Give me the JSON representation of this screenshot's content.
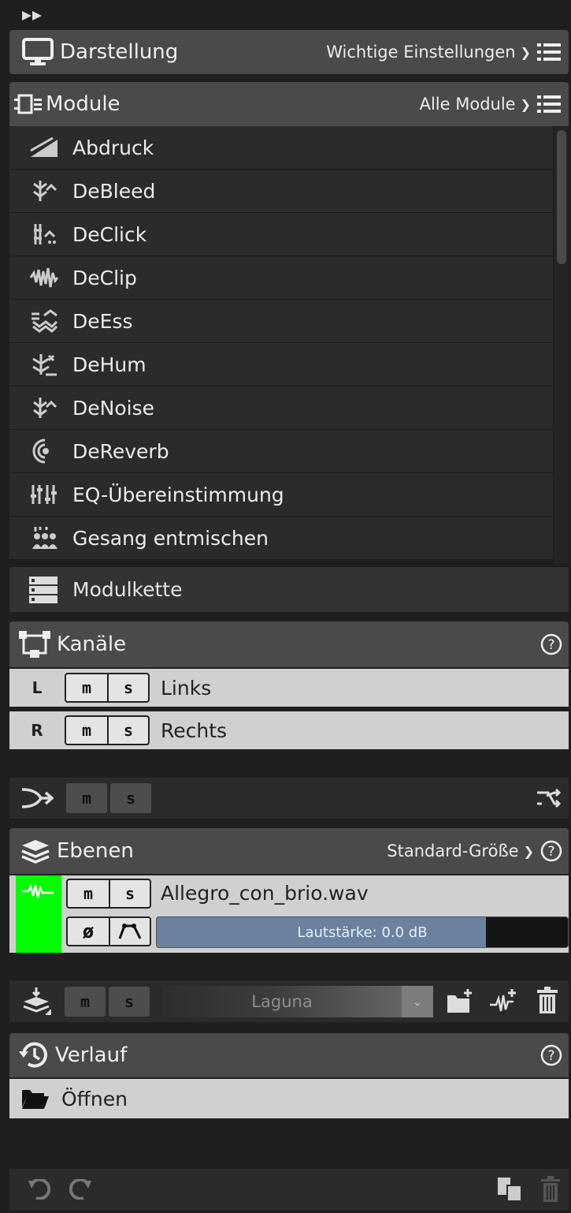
{
  "display": {
    "title": "Darstellung",
    "preset": "Wichtige Einstellungen"
  },
  "modules": {
    "title": "Module",
    "filter": "Alle Module",
    "items": [
      {
        "label": "Abdruck",
        "icon": "abdruck-icon"
      },
      {
        "label": "DeBleed",
        "icon": "debleed-icon"
      },
      {
        "label": "DeClick",
        "icon": "declick-icon"
      },
      {
        "label": "DeClip",
        "icon": "declip-icon"
      },
      {
        "label": "DeEss",
        "icon": "deess-icon"
      },
      {
        "label": "DeHum",
        "icon": "dehum-icon"
      },
      {
        "label": "DeNoise",
        "icon": "denoise-icon"
      },
      {
        "label": "DeReverb",
        "icon": "dereverb-icon"
      },
      {
        "label": "EQ-Übereinstimmung",
        "icon": "eq-match-icon"
      },
      {
        "label": "Gesang entmischen",
        "icon": "dialogue-isolate-icon"
      }
    ],
    "chain_label": "Modulkette"
  },
  "channels": {
    "title": "Kanäle",
    "rows": [
      {
        "letter": "L",
        "m": "m",
        "s": "s",
        "name": "Links"
      },
      {
        "letter": "R",
        "m": "m",
        "s": "s",
        "name": "Rechts"
      }
    ],
    "routing": {
      "m": "m",
      "s": "s"
    }
  },
  "layers": {
    "title": "Ebenen",
    "size": "Standard-Größe",
    "layer": {
      "m": "m",
      "s": "s",
      "file": "Allegro_con_brio.wav",
      "phase": "ø",
      "volume_text": "Lautstärke: 0.0 dB",
      "volume_fill": 0.8,
      "color": "#00ff00"
    },
    "bottom": {
      "m": "m",
      "s": "s",
      "preset": "Laguna"
    }
  },
  "history": {
    "title": "Verlauf",
    "items": [
      {
        "label": "Öffnen"
      }
    ]
  },
  "colors": {
    "panel_header": "#4a4a4a",
    "row_dark": "#2b2b2b",
    "row_light": "#d0d0d0",
    "layer_green": "#00ff00",
    "volume_blue": "#6a82a0"
  }
}
